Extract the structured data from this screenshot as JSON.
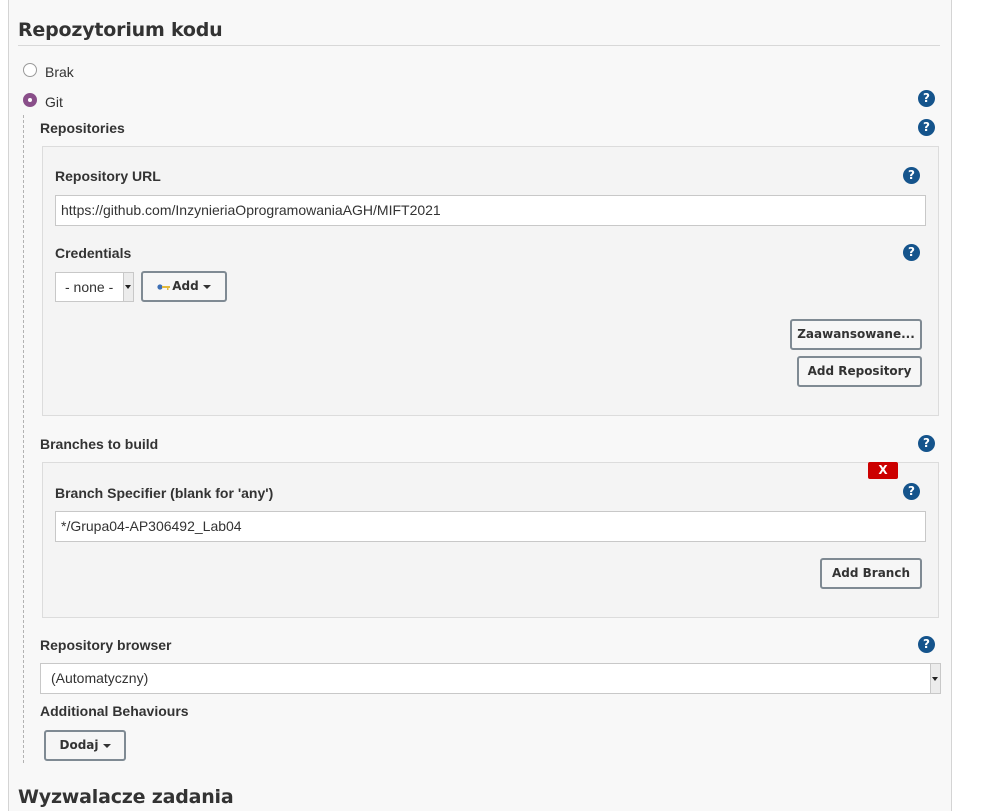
{
  "scm": {
    "title": "Repozytorium kodu",
    "options": [
      {
        "label": "Brak",
        "checked": false
      },
      {
        "label": "Git",
        "checked": true
      }
    ],
    "help_glyph": "?"
  },
  "git": {
    "repositories_label": "Repositories",
    "repository": {
      "url_label": "Repository URL",
      "url_value": "https://github.com/InzynieriaOprogramowaniaAGH/MIFT2021",
      "credentials_label": "Credentials",
      "credentials_value": "- none -",
      "add_label": "Add",
      "advanced_label": "Zaawansowane...",
      "add_repository_label": "Add Repository"
    },
    "branches_label": "Branches to build",
    "branch": {
      "delete_label": "X",
      "specifier_label": "Branch Specifier (blank for 'any')",
      "specifier_value": "*/Grupa04-AP306492_Lab04",
      "add_branch_label": "Add Branch"
    },
    "browser_label": "Repository browser",
    "browser_value": "(Automatyczny)",
    "behaviours_label": "Additional Behaviours",
    "behaviours_add_label": "Dodaj"
  },
  "triggers": {
    "title": "Wyzwalacze zadania"
  },
  "colors": {
    "accent_radio": "#8a4f8a",
    "help_icon": "#15548c",
    "delete_button": "#cc0000"
  }
}
